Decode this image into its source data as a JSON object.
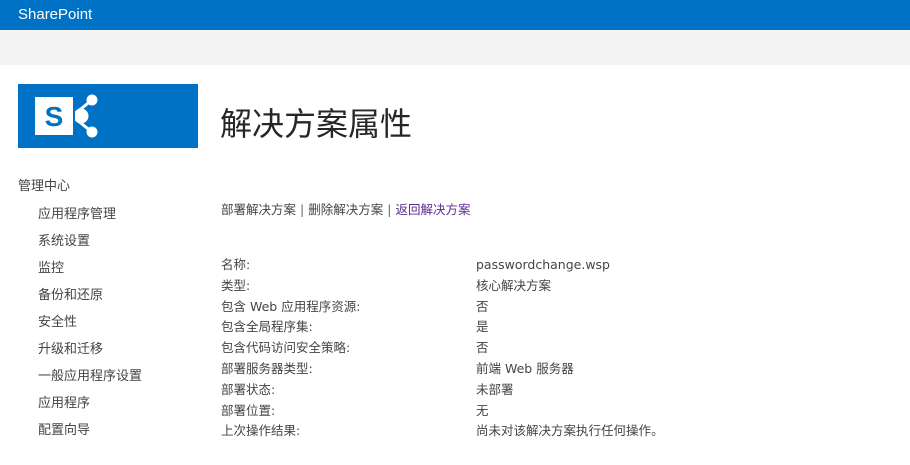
{
  "topbar": {
    "brand": "SharePoint"
  },
  "logo": {
    "icon": "sharepoint-logo-icon",
    "letter": "S"
  },
  "page": {
    "title": "解决方案属性"
  },
  "leftnav": {
    "header": "管理中心",
    "items": [
      {
        "label": "应用程序管理"
      },
      {
        "label": "系统设置"
      },
      {
        "label": "监控"
      },
      {
        "label": "备份和还原"
      },
      {
        "label": "安全性"
      },
      {
        "label": "升级和迁移"
      },
      {
        "label": "一般应用程序设置"
      },
      {
        "label": "应用程序"
      },
      {
        "label": "配置向导"
      }
    ]
  },
  "toolbar": {
    "deploy": "部署解决方案",
    "remove": "删除解决方案",
    "back": "返回解决方案",
    "separator": "|"
  },
  "properties": [
    {
      "label": "名称:",
      "value": "passwordchange.wsp"
    },
    {
      "label": "类型:",
      "value": "核心解决方案"
    },
    {
      "label": "包含 Web 应用程序资源:",
      "value": "否"
    },
    {
      "label": "包含全局程序集:",
      "value": "是"
    },
    {
      "label": "包含代码访问安全策略:",
      "value": "否"
    },
    {
      "label": "部署服务器类型:",
      "value": "前端 Web 服务器"
    },
    {
      "label": "部署状态:",
      "value": "未部署"
    },
    {
      "label": "部署位置:",
      "value": "无"
    },
    {
      "label": "上次操作结果:",
      "value": "尚未对该解决方案执行任何操作。"
    }
  ],
  "colors": {
    "brand_blue": "#0072c6",
    "visited_link": "#5c2d91"
  }
}
